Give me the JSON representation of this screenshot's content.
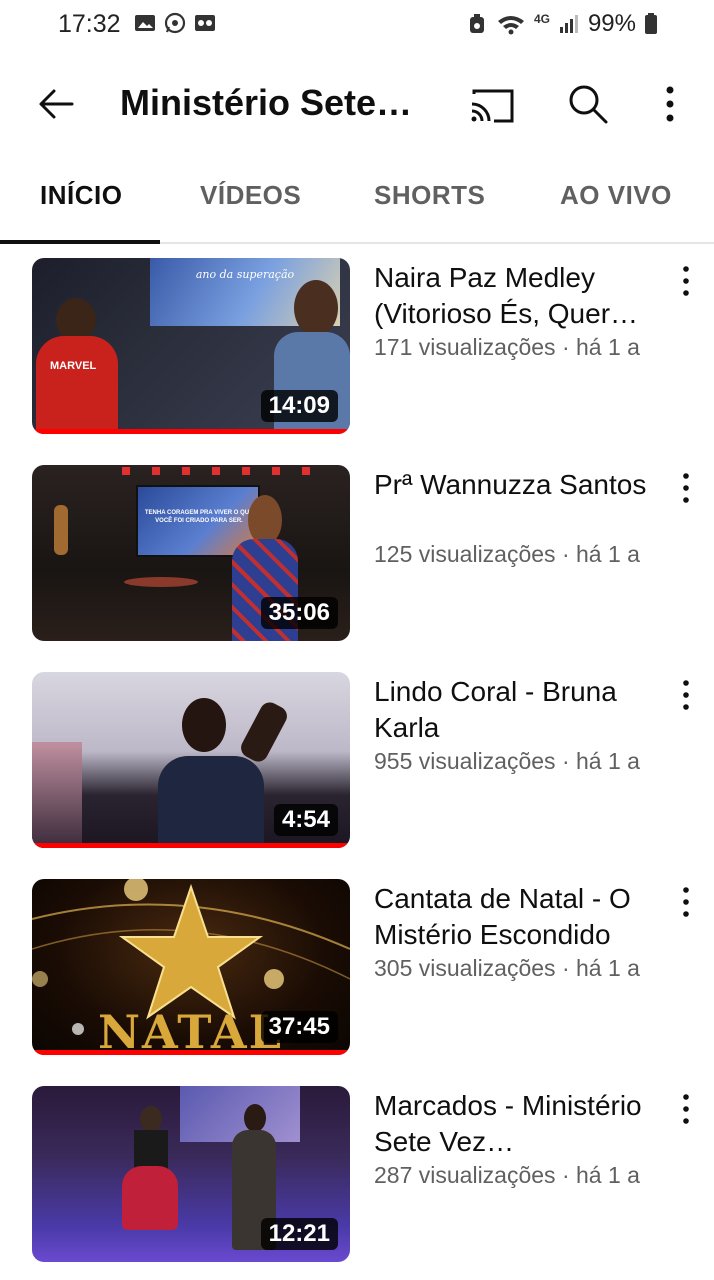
{
  "status_bar": {
    "time": "17:32",
    "battery": "99%",
    "network": "4G",
    "icons": [
      "image-icon",
      "whatsapp-icon",
      "voicemail-icon",
      "alarm-icon",
      "wifi-icon",
      "signal-icon",
      "battery-icon"
    ]
  },
  "header": {
    "title": "Ministério Sete…",
    "icons": [
      "back-arrow-icon",
      "cast-icon",
      "search-icon",
      "more-vert-icon"
    ]
  },
  "tabs": [
    {
      "label": "INÍCIO",
      "active": true
    },
    {
      "label": "VÍDEOS",
      "active": false
    },
    {
      "label": "SHORTS",
      "active": false
    },
    {
      "label": "AO VIVO",
      "active": false
    }
  ],
  "videos": [
    {
      "title": "Naira Paz Medley (Vitorioso És, Quer…",
      "meta": "171 visualizações · há 1 a",
      "duration": "14:09",
      "watched": 1.0
    },
    {
      "title": "Prª Wannuzza Santos",
      "meta": "125 visualizações · há 1 a",
      "duration": "35:06",
      "watched": 0.0
    },
    {
      "title": "Lindo Coral - Bruna Karla",
      "meta": "955 visualizações · há 1 a",
      "duration": "4:54",
      "watched": 1.0
    },
    {
      "title": "Cantata de Natal - O Mistério Escondido",
      "meta": "305 visualizações · há 1 a",
      "duration": "37:45",
      "watched": 1.0
    },
    {
      "title": "Marcados - Ministério Sete Vez…",
      "meta": "287 visualizações · há 1 a",
      "duration": "12:21",
      "watched": 0.0
    }
  ],
  "thumbnail_text": {
    "video_1": "ano da superação",
    "video_2": "TENHA CORAGEM PRA VIVER O QUE VOCÊ FOI CRIADO PARA SER.",
    "video_4": "NATAL"
  },
  "colors": {
    "accent_red": "#ff0000",
    "text_primary": "#0f0f0f",
    "text_secondary": "#606060"
  }
}
